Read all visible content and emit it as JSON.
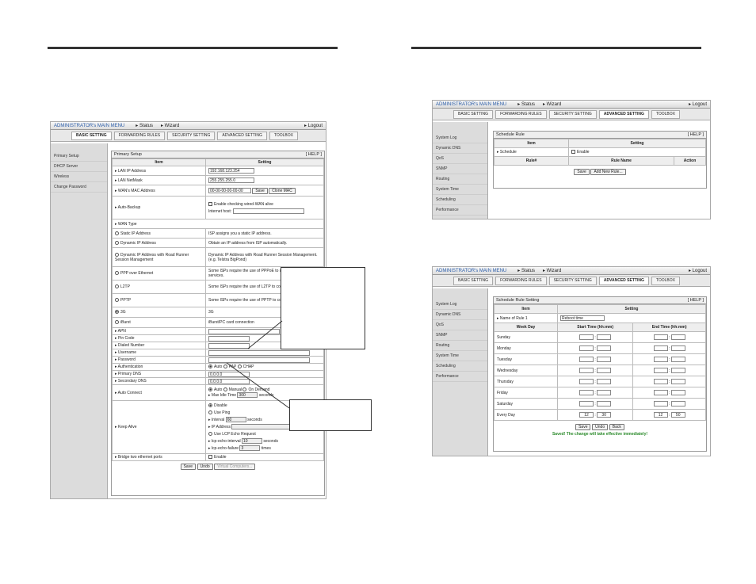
{
  "top": {
    "main_menu": "ADMINISTRATOR's MAIN MENU",
    "status": "Status",
    "wizard": "Wizard",
    "logout": "Logout"
  },
  "tabs": {
    "basic": "BASIC SETTING",
    "forwarding": "FORWARDING RULES",
    "security": "SECURITY SETTING",
    "advanced": "ADVANCED SETTING",
    "toolbox": "TOOLBOX"
  },
  "left_menu": [
    "Primary Setup",
    "DHCP Server",
    "Wireless",
    "Change Password"
  ],
  "right_menu": [
    "System Log",
    "Dynamic DNS",
    "QoS",
    "SNMP",
    "Routing",
    "System Time",
    "Scheduling",
    "Performance"
  ],
  "primary": {
    "title": "Primary Setup",
    "help": "[ HELP ]",
    "col_item": "Item",
    "col_setting": "Setting",
    "lan_ip_label": "LAN IP Address",
    "lan_ip": "192.168.123.254",
    "lan_mask_label": "LAN NetMask",
    "lan_mask": "255.255.255.0",
    "wan_mac_label": "WAN's MAC Address",
    "wan_mac": "00-00-00-00-00-00",
    "save": "Save",
    "clone": "Clone MAC",
    "auto_backup_label": "Auto-Backup",
    "auto_backup_check": "Enable checking wired-WAN alive",
    "internet_host": "Internet host:",
    "wan_type_label": "WAN Type",
    "wan_types": [
      {
        "name": "Static IP Address",
        "desc": "ISP assigns you a static IP address."
      },
      {
        "name": "Dynamic IP Address",
        "desc": "Obtain an IP address from ISP automatically."
      },
      {
        "name": "Dynamic IP Address with Road Runner Session Management",
        "desc": "Dynamic IP Address with Road Runner Session Management.(e.g. Telstra BigPond)"
      },
      {
        "name": "PPP over Ethernet",
        "desc": "Some ISPs require the use of PPPoE to connect to their services."
      },
      {
        "name": "L2TP",
        "desc": "Some ISPs require the use of L2TP to connect to their services."
      },
      {
        "name": "PPTP",
        "desc": "Some ISPs require the use of PPTP to connect to their services."
      },
      {
        "name": "3G",
        "desc": "3G"
      },
      {
        "name": "iBurst",
        "desc": "iBurst/PC card connection"
      }
    ],
    "apn": "APN",
    "pin": "Pin Code",
    "dialed": "Dialed Number",
    "username": "Username",
    "password": "Password",
    "auth": "Authentication",
    "auth_opts": [
      "Auto",
      "PAP",
      "CHAP"
    ],
    "pdns": "Primary DNS",
    "pdns_val": "0.0.0.0",
    "sdns": "Secondary DNS",
    "sdns_val": "0.0.0.0",
    "auto_connect": "Auto Connect",
    "ac_opts": [
      "Auto",
      "Manual",
      "On Demand"
    ],
    "max_idle": "Max Idle Time",
    "max_idle_val": "300",
    "seconds": "seconds",
    "keep_alive": "Keep Alive",
    "ka_disable": "Disable",
    "ka_ping": "Use Ping",
    "interval": "Interval",
    "interval_val": "60",
    "ip_address": "IP Address",
    "ka_lcp": "Use LCP Echo Request",
    "lcp_interval": "lcp-echo-interval",
    "lcp_interval_val": "10",
    "lcp_failure": "lcp-echo-failure",
    "lcp_failure_val": "3",
    "times": "times",
    "bridge": "Bridge two ethernet ports",
    "enable": "Enable",
    "btn_save": "Save",
    "btn_undo": "Undo",
    "btn_virtual": "Virtual Computers..."
  },
  "schedule": {
    "title": "Schedule Rule",
    "help": "[ HELP ]",
    "col_item": "Item",
    "col_setting": "Setting",
    "schedule_label": "Schedule",
    "enable": "Enable",
    "rule_no": "Rule#",
    "rule_name": "Rule Name",
    "action": "Action",
    "save": "Save",
    "add": "Add New Rule..."
  },
  "schedule_setting": {
    "title": "Schedule Rule Setting",
    "help": "[ HELP ]",
    "col_item": "Item",
    "col_setting": "Setting",
    "name_label": "Name of Rule 1",
    "name_val": "Reboot time",
    "col_day": "Week Day",
    "col_start": "Start Time (hh:mm)",
    "col_end": "End Time (hh:mm)",
    "days": [
      "Sunday",
      "Monday",
      "Tuesday",
      "Wednesday",
      "Thursday",
      "Friday",
      "Saturday",
      "Every Day"
    ],
    "every": {
      "sh": "12",
      "sm": "30",
      "eh": "12",
      "em": "50"
    },
    "save": "Save",
    "undo": "Undo",
    "back": "Back",
    "saved_msg": "Saved! The change will take effective immediately!"
  }
}
